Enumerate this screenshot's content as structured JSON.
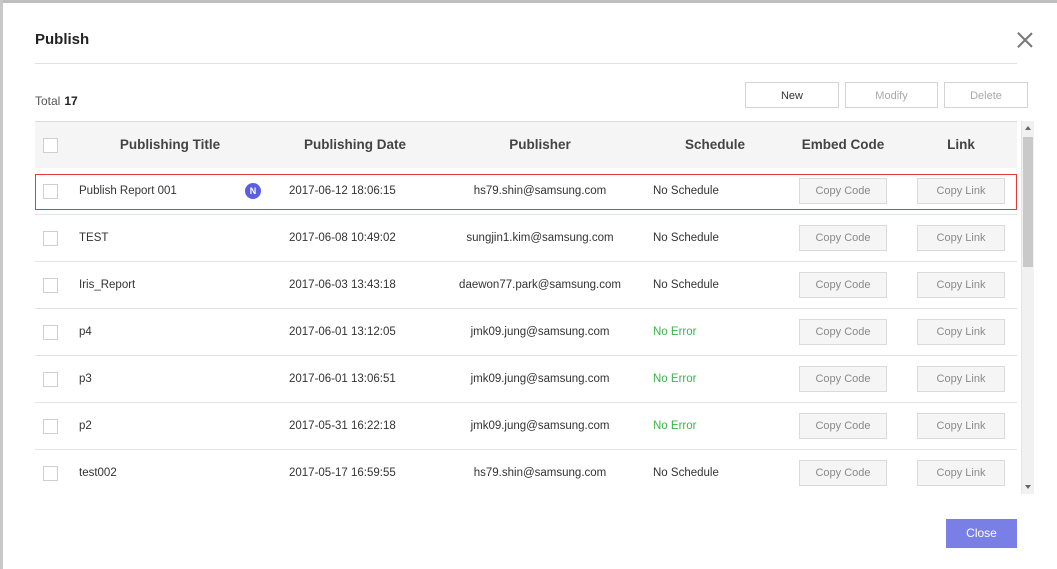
{
  "dialog": {
    "title": "Publish",
    "total_label": "Total",
    "total_count": "17"
  },
  "toolbar": {
    "new_label": "New",
    "modify_label": "Modify",
    "delete_label": "Delete"
  },
  "table": {
    "headers": [
      "Publishing Title",
      "Publishing Date",
      "Publisher",
      "Schedule",
      "Embed Code",
      "Link"
    ],
    "rows": [
      {
        "title": "Publish Report 001",
        "badge": "N",
        "date": "2017-06-12 18:06:15",
        "publisher": "hs79.shin@samsung.com",
        "schedule": "No Schedule",
        "code": "Copy Code",
        "link": "Copy Link"
      },
      {
        "title": "TEST",
        "date": "2017-06-08 10:49:02",
        "publisher": "sungjin1.kim@samsung.com",
        "schedule": "No Schedule",
        "code": "Copy Code",
        "link": "Copy Link"
      },
      {
        "title": "Iris_Report",
        "date": "2017-06-03 13:43:18",
        "publisher": "daewon77.park@samsung.com",
        "schedule": "No Schedule",
        "code": "Copy Code",
        "link": "Copy Link"
      },
      {
        "title": "p4",
        "date": "2017-06-01 13:12:05",
        "publisher": "jmk09.jung@samsung.com",
        "schedule": "No Error",
        "code": "Copy Code",
        "link": "Copy Link"
      },
      {
        "title": "p3",
        "date": "2017-06-01 13:06:51",
        "publisher": "jmk09.jung@samsung.com",
        "schedule": "No Error",
        "code": "Copy Code",
        "link": "Copy Link"
      },
      {
        "title": "p2",
        "date": "2017-05-31 16:22:18",
        "publisher": "jmk09.jung@samsung.com",
        "schedule": "No Error",
        "code": "Copy Code",
        "link": "Copy Link"
      },
      {
        "title": "test002",
        "date": "2017-05-17 16:59:55",
        "publisher": "hs79.shin@samsung.com",
        "schedule": "No Schedule",
        "code": "Copy Code",
        "link": "Copy Link"
      }
    ]
  },
  "footer": {
    "close_label": "Close"
  },
  "colors": {
    "accent": "#7a7fe6",
    "badge": "#5a5ee0",
    "success": "#3bb54a",
    "selection": "#e03a3a"
  },
  "icons": {
    "close": "close-icon",
    "scroll_up": "scroll-up-arrow-icon",
    "scroll_down": "scroll-down-arrow-icon"
  }
}
